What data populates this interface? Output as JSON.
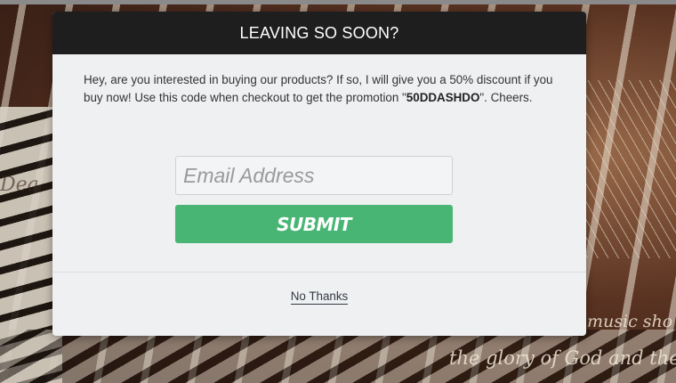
{
  "background": {
    "text_fragment_left": "Dea",
    "text_line_1": "music sho",
    "text_line_2": "the glory of God and the re"
  },
  "modal": {
    "title": "LEAVING SO SOON?",
    "message_before_code": "Hey, are you interested in buying our products? If so, I will give you a 50% discount if you buy now! Use this code when checkout to get the promotion \"",
    "promo_code": "50DDASHDO",
    "message_after_code": "\". Cheers.",
    "email_placeholder": "Email Address",
    "email_value": "",
    "submit_label": "SUBMIT",
    "no_thanks_label": "No Thanks"
  },
  "colors": {
    "header_bg": "#1e1e1e",
    "modal_bg": "#eff0f2",
    "submit_bg": "#48b574"
  }
}
